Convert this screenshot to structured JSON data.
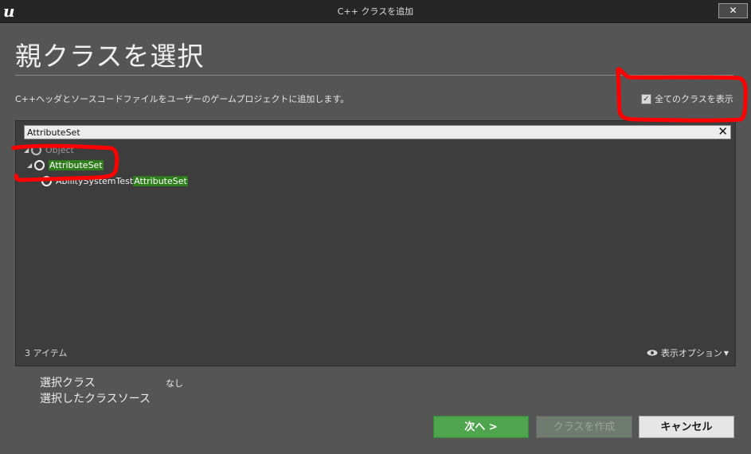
{
  "window": {
    "title": "C++ クラスを追加",
    "close_label": "✕"
  },
  "heading": "親クラスを選択",
  "description": "C++ヘッダとソースコードファイルをユーザーのゲームプロジェクトに追加します。",
  "show_all_classes": {
    "label": "全てのクラスを表示",
    "checked": true
  },
  "search": {
    "value": "AttributeSet",
    "clear_label": "✕"
  },
  "tree": {
    "root": {
      "label": "Object"
    },
    "match": {
      "label": "AttributeSet"
    },
    "child": {
      "prefix": "AbilitySystemTest",
      "match": "AttributeSet"
    }
  },
  "footer": {
    "item_count": "3 アイテム",
    "view_options": "表示オプション"
  },
  "selection": {
    "class_label": "選択クラス",
    "class_value": "なし",
    "source_label": "選択したクラスソース"
  },
  "buttons": {
    "next": "次へ >",
    "create": "クラスを作成",
    "cancel": "キャンセル"
  },
  "colors": {
    "highlight": "#2f7d1d",
    "next_button": "#4ea54e",
    "annotation": "#ff0000"
  }
}
